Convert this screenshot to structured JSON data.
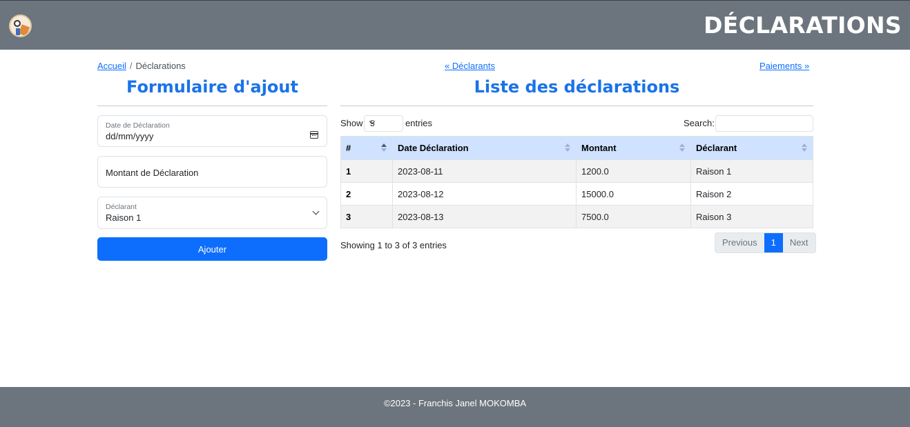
{
  "header": {
    "title": "DÉCLARATIONS",
    "logo_icon": "avatar-logo"
  },
  "breadcrumb": {
    "home": "Accueil",
    "separator": "/",
    "current": "Déclarations"
  },
  "nav": {
    "prev_link": "« Déclarants",
    "next_link": "Paiements »"
  },
  "form": {
    "title": "Formulaire d'ajout",
    "date_label": "Date de Déclaration",
    "date_value": "dd/mm/yyyy",
    "amount_placeholder": "Montant de Déclaration",
    "declarant_label": "Déclarant",
    "declarant_value": "Raison 1",
    "submit_label": "Ajouter"
  },
  "list": {
    "title": "Liste des déclarations",
    "show_label": "Show",
    "page_length": "5",
    "entries_label": "entries",
    "search_label": "Search:",
    "columns": [
      "#",
      "Date Déclaration",
      "Montant",
      "Déclarant"
    ],
    "rows": [
      {
        "id": "1",
        "date": "2023-08-11",
        "amount": "1200.0",
        "declarant": "Raison 1"
      },
      {
        "id": "2",
        "date": "2023-08-12",
        "amount": "15000.0",
        "declarant": "Raison 2"
      },
      {
        "id": "3",
        "date": "2023-08-13",
        "amount": "7500.0",
        "declarant": "Raison 3"
      }
    ],
    "info": "Showing 1 to 3 of 3 entries",
    "pagination": {
      "previous": "Previous",
      "current": "1",
      "next": "Next"
    }
  },
  "footer": {
    "text": "©2023 - Franchis Janel MOKOMBA"
  },
  "colors": {
    "header_bg": "#6c757d",
    "accent": "#0d6efd",
    "table_head": "#cfe2ff"
  }
}
